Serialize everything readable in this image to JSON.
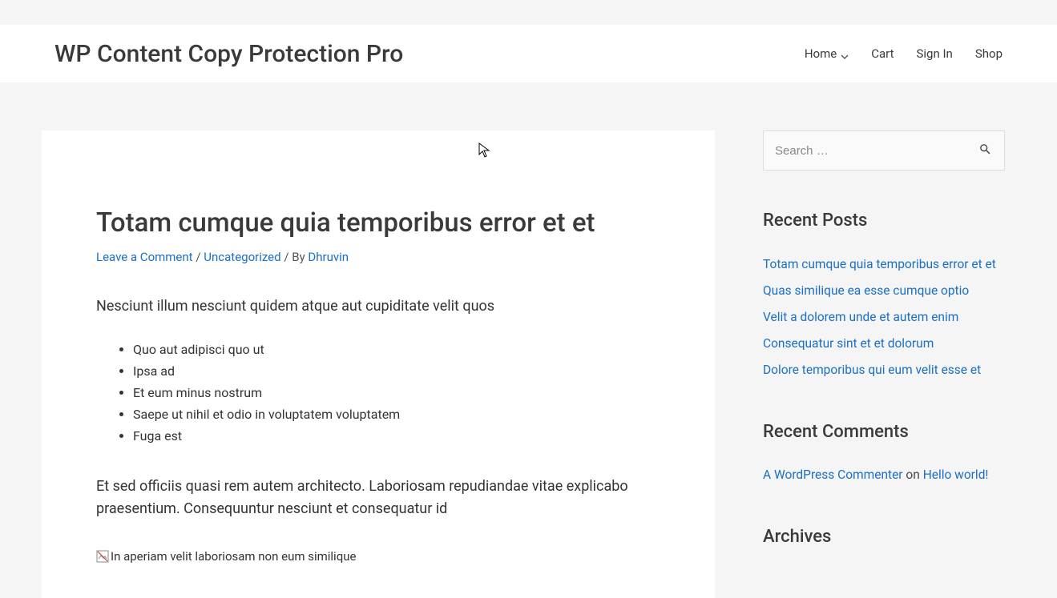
{
  "site": {
    "title": "WP Content Copy Protection Pro"
  },
  "nav": {
    "home": "Home",
    "cart": "Cart",
    "signin": "Sign In",
    "shop": "Shop"
  },
  "post": {
    "title": "Totam cumque quia temporibus error et et",
    "meta": {
      "leave_comment": "Leave a Comment",
      "sep1": "/",
      "category": "Uncategorized",
      "sep2": "/ By",
      "author": "Dhruvin"
    },
    "lead": "Nesciunt illum nesciunt quidem atque aut cupiditate velit quos",
    "bullets": [
      "Quo aut adipisci quo ut",
      "Ipsa ad",
      "Et eum minus nostrum",
      "Saepe ut nihil et odio in voluptatem voluptatem",
      "Fuga est"
    ],
    "paragraph": "Et sed officiis quasi rem autem architecto. Laboriosam repudiandae vitae explicabo praesentium. Consequuntur nesciunt et consequatur id",
    "broken_image_alt": "In aperiam velit laboriosam non eum similique"
  },
  "sidebar": {
    "search_placeholder": "Search …",
    "recent_posts_title": "Recent Posts",
    "recent_posts": [
      "Totam cumque quia temporibus error et et",
      "Quas similique ea esse cumque optio",
      "Velit a dolorem unde et autem enim",
      "Consequatur sint et et dolorum",
      "Dolore temporibus qui eum velit esse et"
    ],
    "recent_comments_title": "Recent Comments",
    "recent_comment": {
      "author": "A WordPress Commenter",
      "on": "on",
      "post": "Hello world!"
    },
    "archives_title": "Archives"
  }
}
